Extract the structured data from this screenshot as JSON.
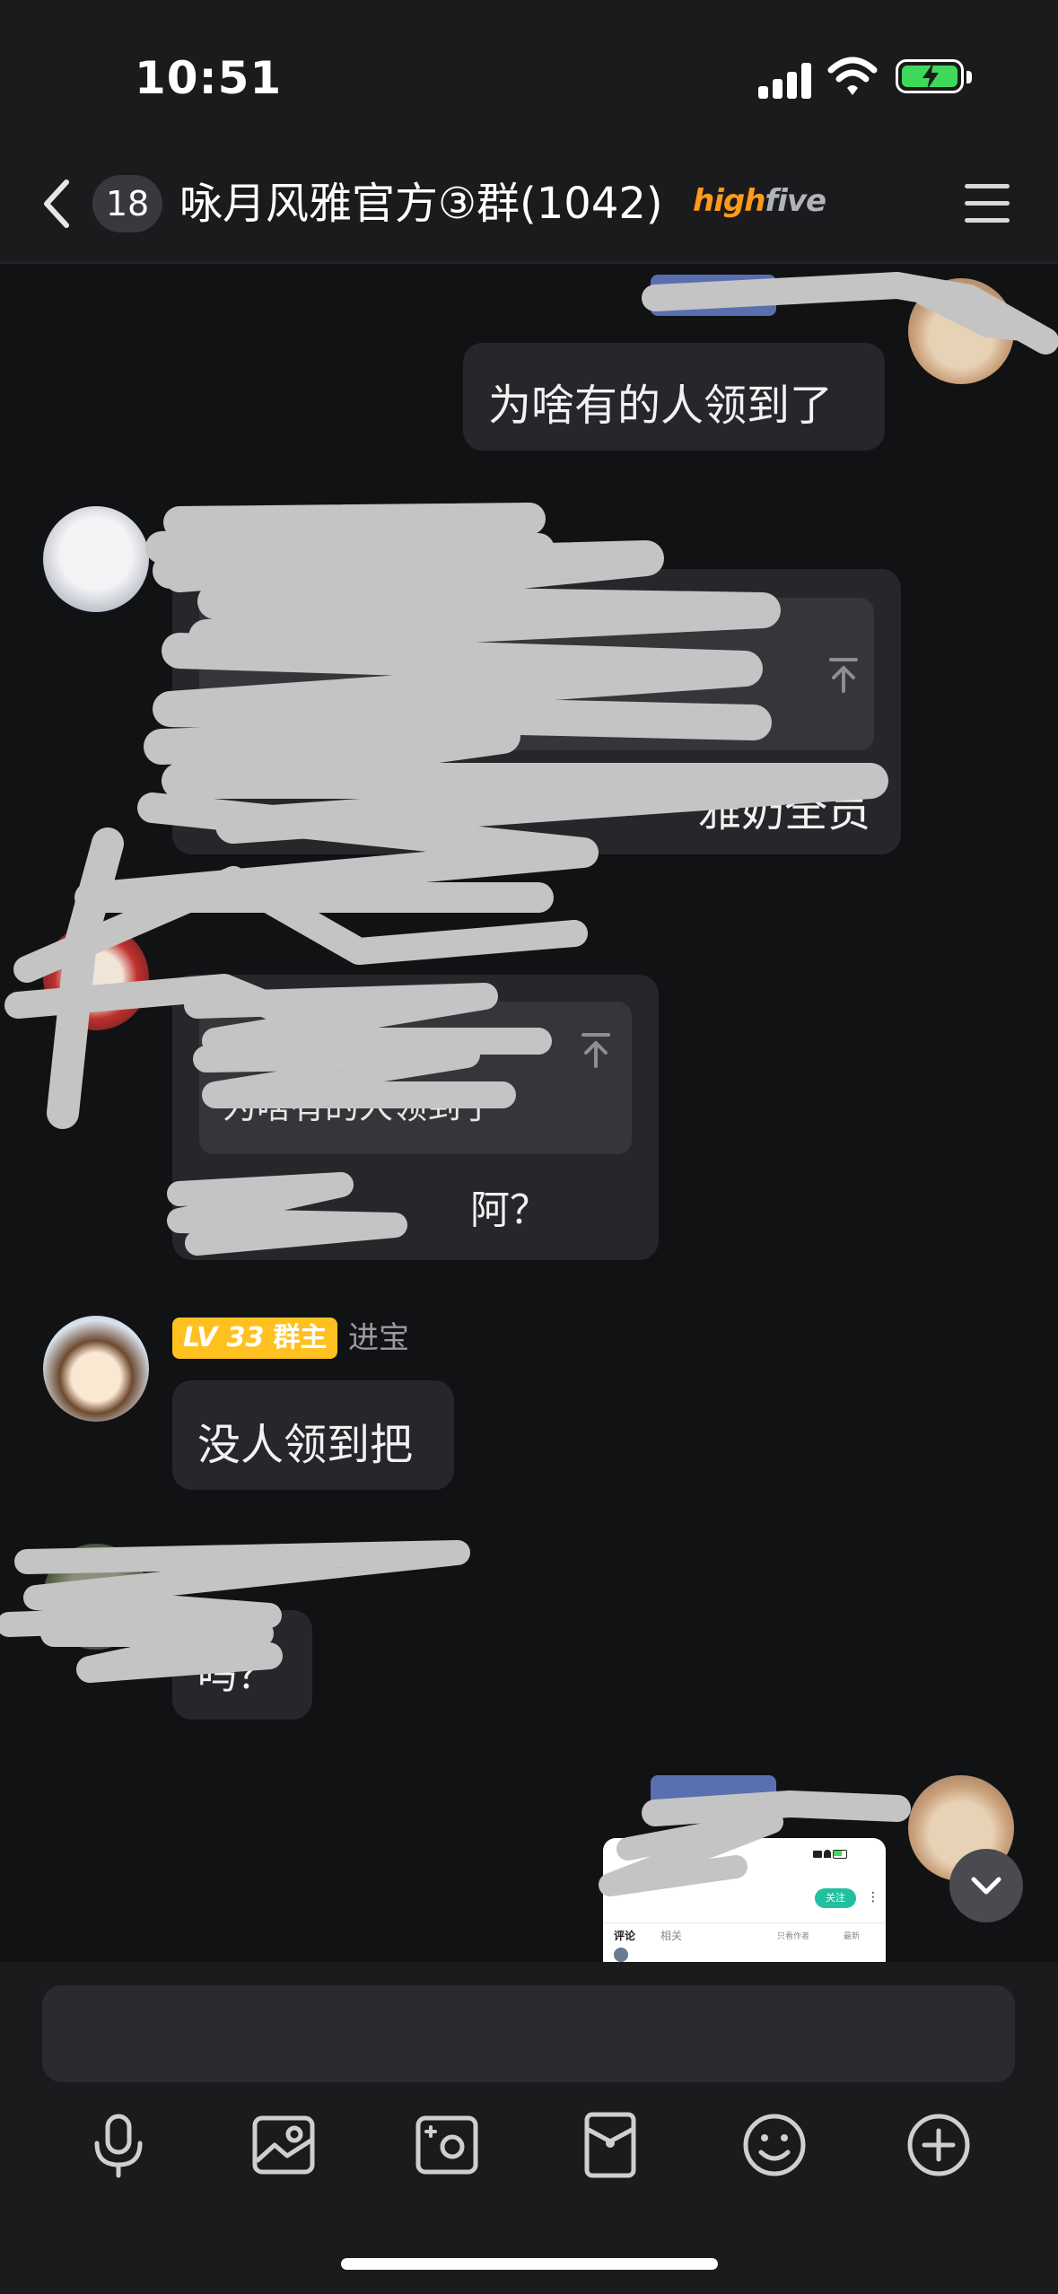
{
  "status_bar": {
    "time": "10:51"
  },
  "header": {
    "unread_count": "18",
    "title": "咏月风雅官方③群(1042)",
    "badge_high": "high",
    "badge_five": "five"
  },
  "messages": [
    {
      "side": "right",
      "text": "为啥有的人领到了"
    },
    {
      "side": "left",
      "quote_text": "",
      "text": "雅奶全员"
    },
    {
      "side": "left",
      "quote_text": "为啥有的人领到了",
      "text": "阿？"
    },
    {
      "side": "left",
      "sender": {
        "level": "LV 33",
        "role": "群主",
        "name": "进宝"
      },
      "text": "没人领到把"
    },
    {
      "side": "left",
      "text": "吗？"
    }
  ],
  "thumbnail": {
    "status_time": "10:51",
    "follow_label": "关注",
    "tab_comments": "评论",
    "tab_related": "相关",
    "filter_author": "只看作者",
    "sort_latest": "最新"
  },
  "input": {
    "placeholder": ""
  },
  "toolbar": [
    "mic-icon",
    "image-icon",
    "camera-icon",
    "red-packet-icon",
    "emoji-icon",
    "plus-icon"
  ],
  "colors": {
    "background": "#111214",
    "bubble": "#26272b",
    "level_badge": "#ffc11f",
    "battery": "#3ed95b",
    "highfive": "#ff9a1a"
  }
}
